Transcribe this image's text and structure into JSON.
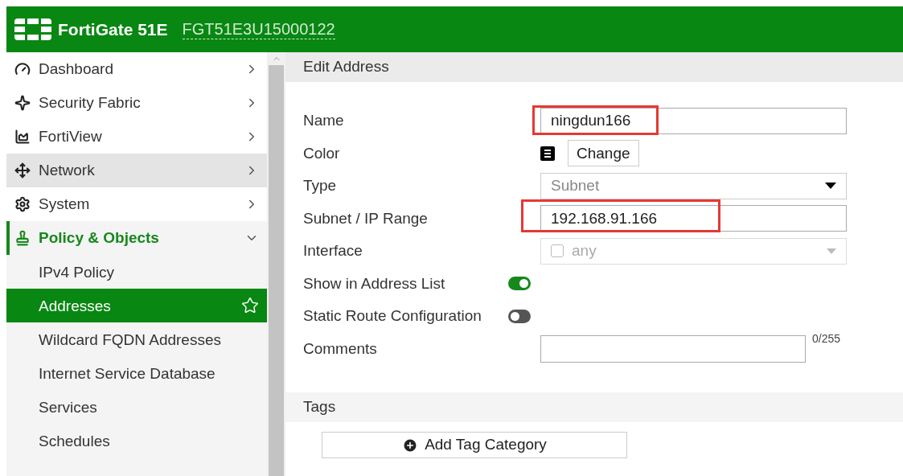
{
  "header": {
    "product": "FortiGate 51E",
    "serial": "FGT51E3U15000122"
  },
  "sidebar": {
    "items": [
      {
        "kind": "menu",
        "label": "Dashboard",
        "selected": false,
        "highlighted": false,
        "expanded": false
      },
      {
        "kind": "menu",
        "label": "Security Fabric",
        "selected": false,
        "highlighted": false,
        "expanded": false
      },
      {
        "kind": "menu",
        "label": "FortiView",
        "selected": false,
        "highlighted": false,
        "expanded": false
      },
      {
        "kind": "menu",
        "label": "Network",
        "selected": false,
        "highlighted": true,
        "expanded": false
      },
      {
        "kind": "menu",
        "label": "System",
        "selected": false,
        "highlighted": false,
        "expanded": false
      },
      {
        "kind": "menu",
        "label": "Policy & Objects",
        "selected": true,
        "highlighted": false,
        "expanded": true
      },
      {
        "kind": "sub",
        "label": "IPv4 Policy",
        "selected": false
      },
      {
        "kind": "sub",
        "label": "Addresses",
        "selected": true
      },
      {
        "kind": "sub",
        "label": "Wildcard FQDN Addresses",
        "selected": false
      },
      {
        "kind": "sub",
        "label": "Internet Service Database",
        "selected": false
      },
      {
        "kind": "sub",
        "label": "Services",
        "selected": false
      },
      {
        "kind": "sub",
        "label": "Schedules",
        "selected": false
      }
    ]
  },
  "form": {
    "title": "Edit Address",
    "rows": [
      {
        "kind": "text",
        "label": "Name",
        "value": "ningdun166",
        "highlighted": true
      },
      {
        "kind": "color",
        "label": "Color",
        "button": "Change"
      },
      {
        "kind": "select",
        "label": "Type",
        "value": "Subnet",
        "disabled": true
      },
      {
        "kind": "text",
        "label": "Subnet / IP Range",
        "value": "192.168.91.166",
        "highlighted": true
      },
      {
        "kind": "interface",
        "label": "Interface",
        "value": "any",
        "disabled": true,
        "checked": false
      },
      {
        "kind": "toggle",
        "label": "Show in Address List",
        "on": true
      },
      {
        "kind": "toggle",
        "label": "Static Route Configuration",
        "on": false
      },
      {
        "kind": "textarea",
        "label": "Comments",
        "counter": "0/255"
      }
    ]
  },
  "tags": {
    "title": "Tags",
    "button": "Add Tag Category"
  }
}
